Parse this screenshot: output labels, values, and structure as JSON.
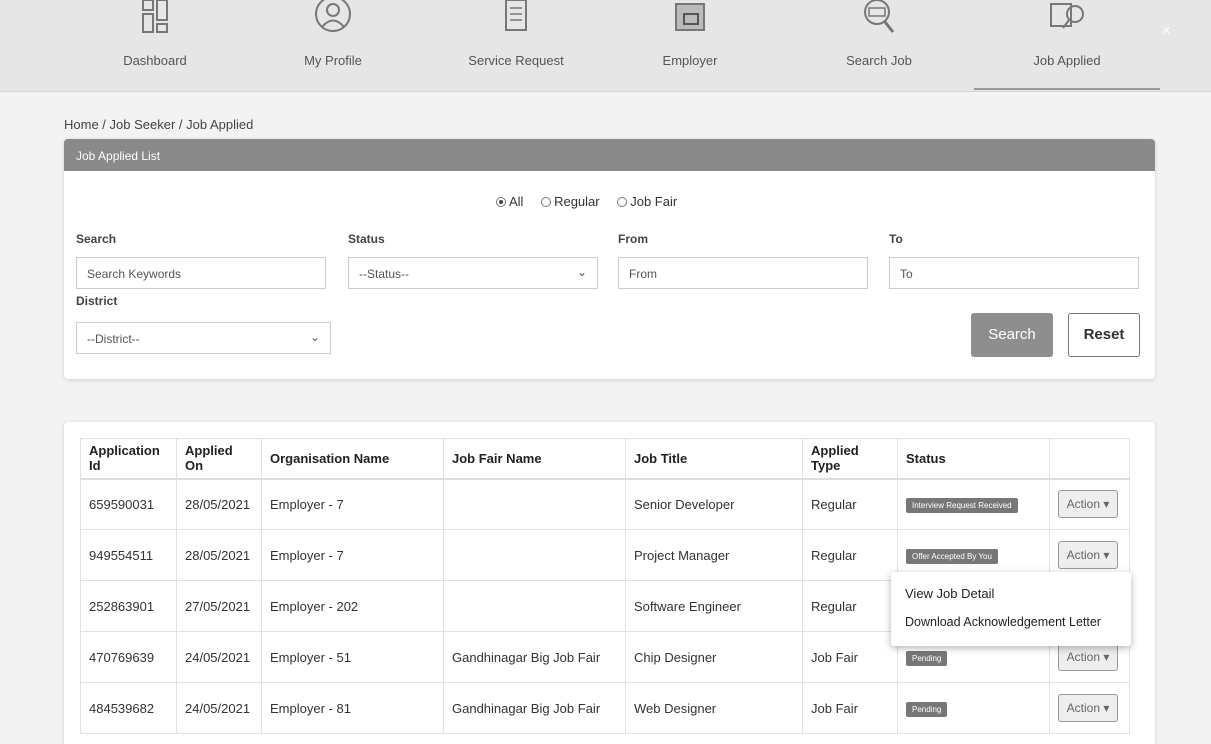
{
  "nav": {
    "items": [
      {
        "label": "Dashboard",
        "icon": "dashboard-grid-icon"
      },
      {
        "label": "My Profile",
        "icon": "user-profile-icon"
      },
      {
        "label": "Service Request",
        "icon": "document-list-icon"
      },
      {
        "label": "Employer",
        "icon": "briefcase-icon"
      },
      {
        "label": "Search Job",
        "icon": "job-search-icon"
      },
      {
        "label": "Job Applied",
        "icon": "job-applied-icon"
      }
    ],
    "active": "Job Applied"
  },
  "breadcrumb": "Home / Job Seeker / Job Applied",
  "filter": {
    "title": "Job Applied List",
    "radios": {
      "all": "All",
      "regular": "Regular",
      "job_fair": "Job Fair",
      "selected": "All"
    },
    "search_label": "Search",
    "search_placeholder": "Search Keywords",
    "status_label": "Status",
    "status_value": "--Status--",
    "from_label": "From",
    "from_placeholder": "From",
    "to_label": "To",
    "to_placeholder": "To",
    "district_label": "District",
    "district_value": "--District--",
    "search_button": "Search",
    "reset_button": "Reset"
  },
  "table": {
    "headers": {
      "application_id": "Application Id",
      "applied_on": "Applied On",
      "organisation": "Organisation Name",
      "job_fair": "Job Fair Name",
      "job_title": "Job Title",
      "applied_type": "Applied Type",
      "status": "Status"
    },
    "action_label": "Action ▾",
    "rows": [
      {
        "id": "659590031",
        "date": "28/05/2021",
        "org": "Employer - 7",
        "fair": "",
        "title": "Senior Developer",
        "type": "Regular",
        "status": "Interview Request Received"
      },
      {
        "id": "949554511",
        "date": "28/05/2021",
        "org": "Employer - 7",
        "fair": "",
        "title": "Project Manager",
        "type": "Regular",
        "status": "Offer Accepted By You"
      },
      {
        "id": "252863901",
        "date": "27/05/2021",
        "org": "Employer - 202",
        "fair": "",
        "title": "Software Engineer",
        "type": "Regular",
        "status": ""
      },
      {
        "id": "470769639",
        "date": "24/05/2021",
        "org": "Employer - 51",
        "fair": "Gandhinagar Big Job Fair",
        "title": "Chip Designer",
        "type": "Job Fair",
        "status": "Pending"
      },
      {
        "id": "484539682",
        "date": "24/05/2021",
        "org": "Employer - 81",
        "fair": "Gandhinagar Big Job Fair",
        "title": "Web Designer",
        "type": "Job Fair",
        "status": "Pending"
      }
    ]
  },
  "dropdown": {
    "view": "View Job Detail",
    "download": "Download Acknowledgement Letter"
  }
}
